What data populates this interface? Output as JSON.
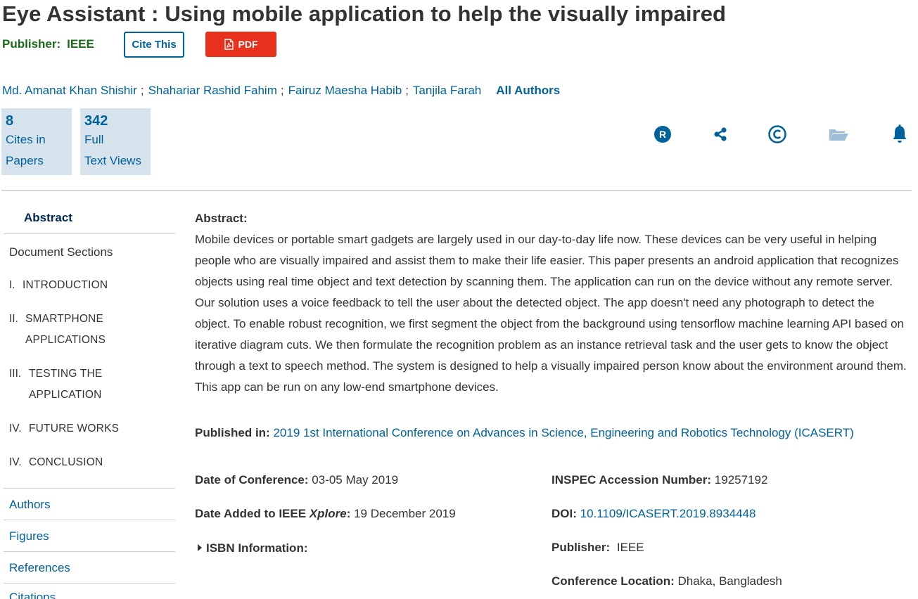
{
  "article": {
    "title": "Eye Assistant : Using mobile application to help the visually impaired",
    "publisher_label": "Publisher:",
    "publisher": "IEEE",
    "cite_label": "Cite This",
    "pdf_label": "PDF"
  },
  "authors": {
    "list": [
      "Md. Amanat Khan Shishir",
      "Shahariar Rashid Fahim",
      "Fairuz Maesha Habib",
      "Tanjila Farah"
    ],
    "separator": ";",
    "all_label": "All Authors"
  },
  "metrics": [
    {
      "number": "8",
      "line1": "Cites in",
      "line2": "Papers"
    },
    {
      "number": "342",
      "line1": "Full",
      "line2": "Text Views"
    }
  ],
  "tools": [
    "rights-icon",
    "share-icon",
    "copyright-icon",
    "folder-icon",
    "bell-icon"
  ],
  "sidebar": {
    "abstract": "Abstract",
    "document_sections": "Document Sections",
    "sections": [
      {
        "num": "I.",
        "line1": "INTRODUCTION",
        "line2": ""
      },
      {
        "num": "II.",
        "line1": "SMARTPHONE",
        "line2": "APPLICATIONS"
      },
      {
        "num": "III.",
        "line1": "TESTING THE",
        "line2": "APPLICATION"
      },
      {
        "num": "IV.",
        "line1": "FUTURE WORKS",
        "line2": ""
      },
      {
        "num": "IV.",
        "line1": "CONCLUSION",
        "line2": ""
      }
    ],
    "links": [
      "Authors",
      "Figures",
      "References",
      "Citations"
    ]
  },
  "abstract": {
    "heading": "Abstract:",
    "body": "Mobile devices or portable smart gadgets are largely used in our day-to-day life now. These devices can be very useful in helping people who are visually impaired and assist them to make their life easier. This paper presents an android application that recognizes objects using real time object and text detection by scanning them. The application can run on the device without any remote server. Our solution uses a voice feedback to tell the user about the detected object. The app doesn't need any photograph to detect the object. To enable robust recognition, we first segment the object from the background using tensorflow machine learning API based on iterative diagram cuts. We then formulate the recognition problem as an instance retrieval task and the user gets to know the object through a text to speech method. The system is designed to help a visually impaired person know about the environment around them. This app can be run on any low-end smartphone devices."
  },
  "published_in": {
    "label": "Published in:",
    "value": "2019 1st International Conference on Advances in Science, Engineering and Robotics Technology (ICASERT)"
  },
  "meta": {
    "date_conf_label": "Date of Conference:",
    "date_conf": "03-05 May 2019",
    "date_added_label_a": "Date Added to IEEE ",
    "date_added_label_b": "Xplore",
    "date_added_label_c": ":",
    "date_added": "19 December 2019",
    "isbn_label": "ISBN Information:",
    "inspec_label": "INSPEC Accession Number:",
    "inspec": "19257192",
    "doi_label": "DOI:",
    "doi": "10.1109/ICASERT.2019.8934448",
    "publisher_label": "Publisher:",
    "publisher": "IEEE",
    "location_label": "Conference Location:",
    "location": "Dhaka, Bangladesh"
  },
  "colors": {
    "link": "#00629b",
    "publisher_green": "#1b6b1b",
    "pdf_red": "#e8311d",
    "metric_bg": "#d6e3ec",
    "nav_dark": "#002855"
  }
}
